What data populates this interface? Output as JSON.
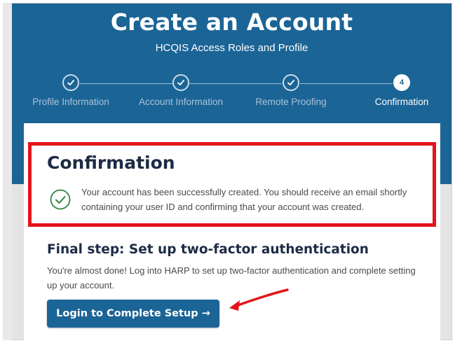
{
  "header": {
    "title": "Create an Account",
    "subtitle": "HCQIS Access Roles and Profile"
  },
  "stepper": {
    "steps": [
      {
        "label": "Profile Information",
        "status": "complete",
        "icon": "check-icon"
      },
      {
        "label": "Account Information",
        "status": "complete",
        "icon": "check-icon"
      },
      {
        "label": "Remote Proofing",
        "status": "complete",
        "icon": "check-icon"
      },
      {
        "label": "Confirmation",
        "status": "current",
        "number": "4"
      }
    ]
  },
  "confirmation": {
    "heading": "Confirmation",
    "icon": "check-circle-icon",
    "message": "Your account has been successfully created. You should receive an email shortly containing your user ID and confirming that your account was created."
  },
  "final_step": {
    "heading": "Final step: Set up two-factor authentication",
    "text": "You're almost done! Log into HARP to set up two-factor authentication and complete setting up your account.",
    "button_label": "Login to Complete Setup →"
  },
  "annotations": {
    "highlight_color": "#e3141b",
    "arrow_color": "#e3141b"
  },
  "colors": {
    "brand": "#1b6496",
    "heading": "#1d2b45",
    "body_text": "#4a4a4a"
  }
}
